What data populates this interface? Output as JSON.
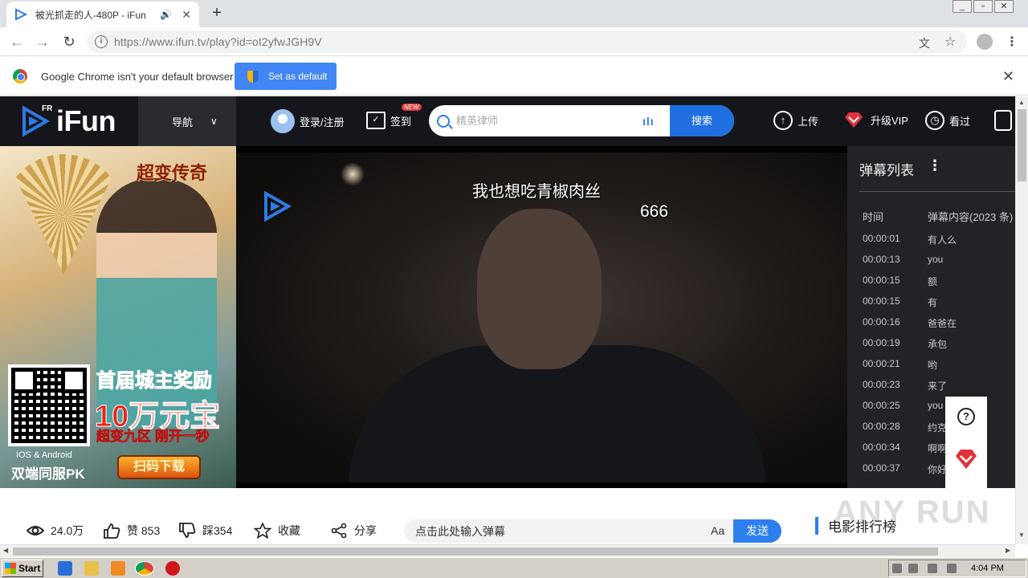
{
  "browser": {
    "tab_title": "被光抓走的人-480P - iFun",
    "tab_sound_icon": "speaker-icon",
    "url": "https://www.ifun.tv/play?id=oI2yfwJGH9V",
    "window_controls": [
      "_",
      "▫",
      "✕"
    ]
  },
  "infobar": {
    "message": "Google Chrome isn't your default browser",
    "button": "Set as default"
  },
  "header": {
    "logo_fr": "FR",
    "logo_name": "iFun",
    "nav_label": "导航",
    "login_label": "登录/注册",
    "checkin_label": "签到",
    "checkin_badge": "NEW",
    "search_placeholder": "精英律师",
    "search_button": "搜索",
    "upload_label": "上传",
    "vip_label": "升级VIP",
    "history_label": "看过"
  },
  "ad": {
    "game_title": "超变传奇",
    "promo_line1": "首届城主奖励",
    "promo_line2": "10万元宝",
    "promo_line3": "超变九区 刚开一秒",
    "download_button": "扫码下载",
    "platforms": "IOS & Android",
    "pk_text": "双端同服PK"
  },
  "player": {
    "danmaku": [
      {
        "text": "我也想吃青椒肉丝"
      },
      {
        "text": "666"
      }
    ]
  },
  "danmaku_list": {
    "title": "弹幕列表",
    "col_time": "时间",
    "col_content": "弹幕内容(2023 条)",
    "rows": [
      {
        "time": "00:00:01",
        "content": "有人么"
      },
      {
        "time": "00:00:13",
        "content": "you"
      },
      {
        "time": "00:00:15",
        "content": "额"
      },
      {
        "time": "00:00:15",
        "content": "有"
      },
      {
        "time": "00:00:16",
        "content": "爸爸在"
      },
      {
        "time": "00:00:19",
        "content": "承包"
      },
      {
        "time": "00:00:21",
        "content": "哟"
      },
      {
        "time": "00:00:23",
        "content": "来了"
      },
      {
        "time": "00:00:25",
        "content": "you"
      },
      {
        "time": "00:00:28",
        "content": "约克"
      },
      {
        "time": "00:00:34",
        "content": "啊啊"
      },
      {
        "time": "00:00:37",
        "content": "你好"
      }
    ]
  },
  "actions": {
    "views": "24.0万",
    "likes": "赞 853",
    "dislikes": "踩354",
    "favorite": "收藏",
    "share": "分享",
    "danmaku_placeholder": "点击此处输入弹幕",
    "font_toggle": "Aa",
    "send_button": "发送",
    "rank_title": "电影排行榜",
    "watermark": "ANY RUN"
  },
  "taskbar": {
    "start_label": "Start",
    "time": "4:04 PM"
  },
  "colors": {
    "header_bg": "#15161b",
    "accent_blue": "#1f6fe0",
    "vip_red": "#e0323c"
  }
}
